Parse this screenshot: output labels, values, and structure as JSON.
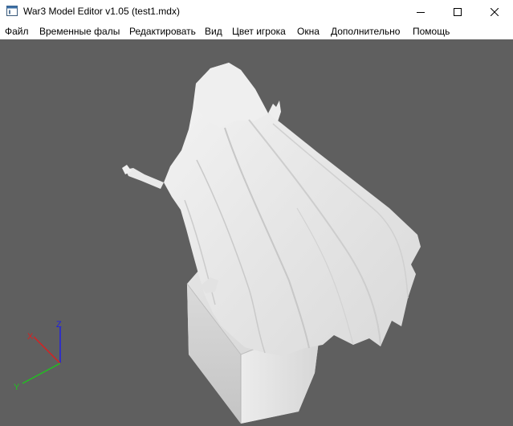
{
  "window": {
    "title": "War3 Model Editor v1.05 (test1.mdx)"
  },
  "menu": {
    "items": [
      {
        "label": "Файл"
      },
      {
        "label": "Временные фалы"
      },
      {
        "label": "Редактировать"
      },
      {
        "label": "Вид"
      },
      {
        "label": "Цвет игрока"
      },
      {
        "label": "Окна"
      },
      {
        "label": "Дополнительно"
      },
      {
        "label": "Помощь"
      }
    ]
  },
  "viewport": {
    "background": "#5f5f5f",
    "axes": {
      "x_label": "X",
      "y_label": "Y",
      "z_label": "Z",
      "x_color": "#d92020",
      "y_color": "#20c020",
      "z_color": "#2020e0"
    }
  },
  "icons": {
    "app": "app-window-icon",
    "minimize": "minimize-icon",
    "maximize": "maximize-icon",
    "close": "close-icon"
  }
}
